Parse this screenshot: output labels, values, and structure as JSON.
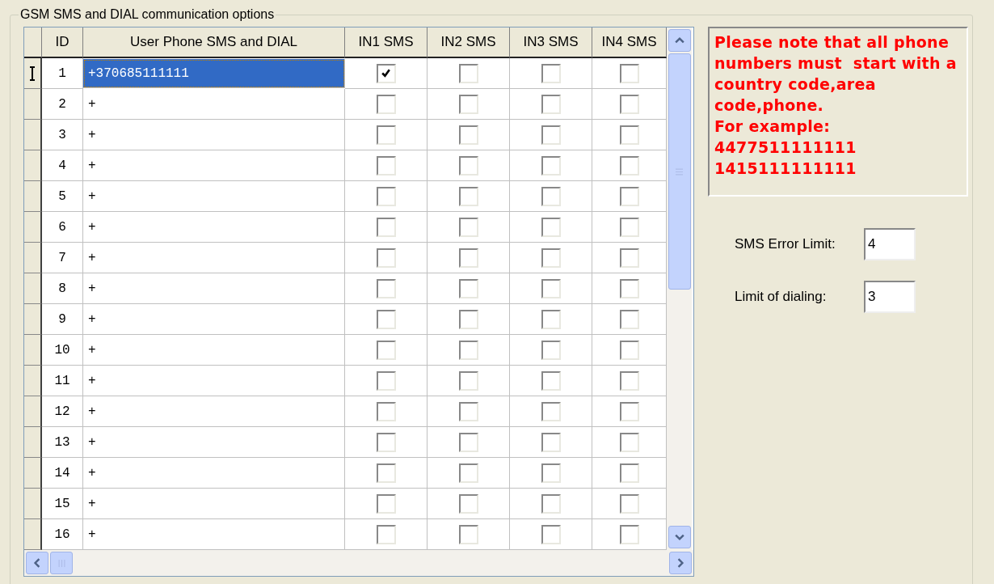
{
  "group": {
    "title": "GSM SMS and DIAL communication options"
  },
  "table": {
    "columns": [
      "ID",
      "User Phone SMS and DIAL",
      "IN1 SMS",
      "IN2 SMS",
      "IN3 SMS",
      "IN4 SMS"
    ],
    "rows": [
      {
        "id": "1",
        "phone": "+370685111111",
        "selected": true,
        "inputs": [
          true,
          false,
          false,
          false
        ]
      },
      {
        "id": "2",
        "phone": "+",
        "selected": false,
        "inputs": [
          false,
          false,
          false,
          false
        ]
      },
      {
        "id": "3",
        "phone": "+",
        "selected": false,
        "inputs": [
          false,
          false,
          false,
          false
        ]
      },
      {
        "id": "4",
        "phone": "+",
        "selected": false,
        "inputs": [
          false,
          false,
          false,
          false
        ]
      },
      {
        "id": "5",
        "phone": "+",
        "selected": false,
        "inputs": [
          false,
          false,
          false,
          false
        ]
      },
      {
        "id": "6",
        "phone": "+",
        "selected": false,
        "inputs": [
          false,
          false,
          false,
          false
        ]
      },
      {
        "id": "7",
        "phone": "+",
        "selected": false,
        "inputs": [
          false,
          false,
          false,
          false
        ]
      },
      {
        "id": "8",
        "phone": "+",
        "selected": false,
        "inputs": [
          false,
          false,
          false,
          false
        ]
      },
      {
        "id": "9",
        "phone": "+",
        "selected": false,
        "inputs": [
          false,
          false,
          false,
          false
        ]
      },
      {
        "id": "10",
        "phone": "+",
        "selected": false,
        "inputs": [
          false,
          false,
          false,
          false
        ]
      },
      {
        "id": "11",
        "phone": "+",
        "selected": false,
        "inputs": [
          false,
          false,
          false,
          false
        ]
      },
      {
        "id": "12",
        "phone": "+",
        "selected": false,
        "inputs": [
          false,
          false,
          false,
          false
        ]
      },
      {
        "id": "13",
        "phone": "+",
        "selected": false,
        "inputs": [
          false,
          false,
          false,
          false
        ]
      },
      {
        "id": "14",
        "phone": "+",
        "selected": false,
        "inputs": [
          false,
          false,
          false,
          false
        ]
      },
      {
        "id": "15",
        "phone": "+",
        "selected": false,
        "inputs": [
          false,
          false,
          false,
          false
        ]
      },
      {
        "id": "16",
        "phone": "+",
        "selected": false,
        "inputs": [
          false,
          false,
          false,
          false
        ]
      }
    ]
  },
  "note": [
    "Please note that all phone numbers must  start with a country code,area code,phone.",
    "For example:",
    "4477511111111",
    "1415111111111"
  ],
  "fields": [
    {
      "label": "SMS Error Limit:",
      "value": "4"
    },
    {
      "label": "Limit of dialing:",
      "value": "3"
    }
  ]
}
